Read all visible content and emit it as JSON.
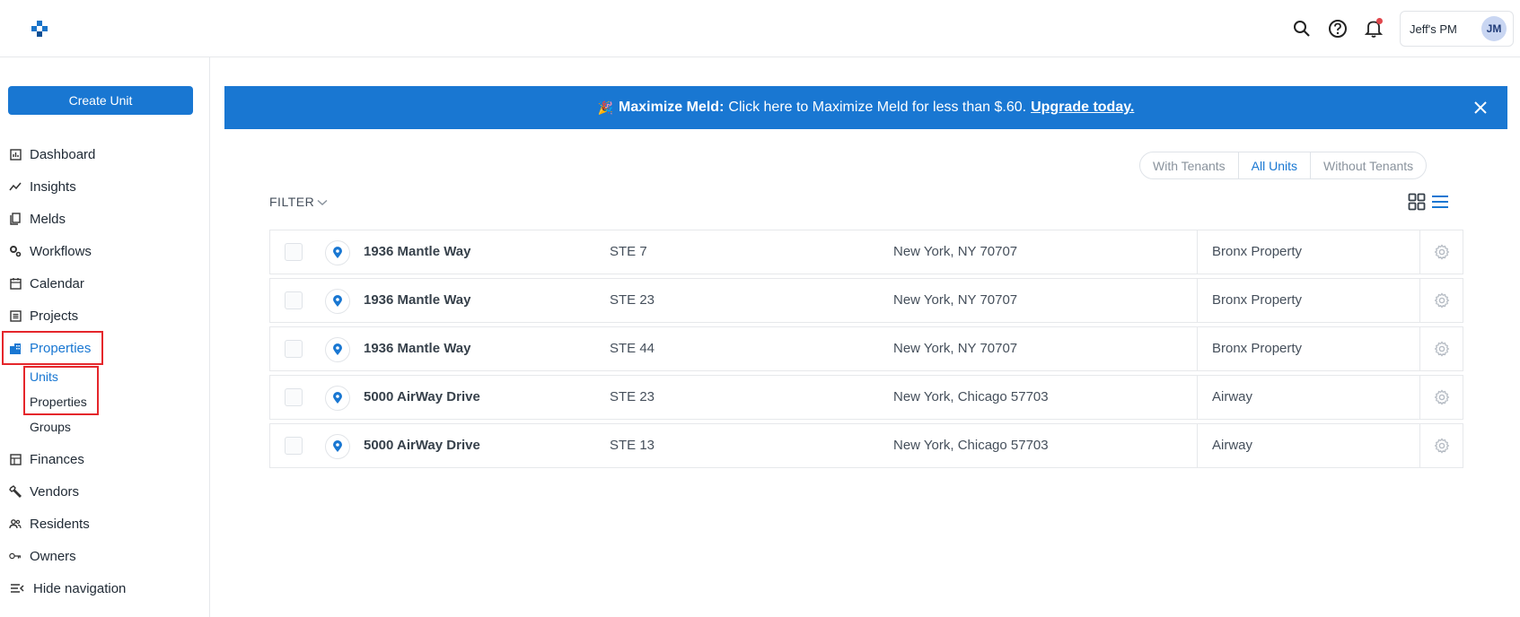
{
  "header": {
    "account_name": "Jeff's PM",
    "avatar_initials": "JM",
    "icons": [
      "logo-icon",
      "search-icon",
      "help-icon",
      "bell-icon"
    ]
  },
  "sidebar": {
    "create_button": "Create Unit",
    "items": [
      {
        "label": "Dashboard",
        "icon": "dashboard-icon"
      },
      {
        "label": "Insights",
        "icon": "insights-icon"
      },
      {
        "label": "Melds",
        "icon": "melds-icon"
      },
      {
        "label": "Workflows",
        "icon": "workflows-icon"
      },
      {
        "label": "Calendar",
        "icon": "calendar-icon"
      },
      {
        "label": "Projects",
        "icon": "projects-icon"
      },
      {
        "label": "Properties",
        "icon": "properties-icon",
        "active": true
      },
      {
        "label": "Finances",
        "icon": "finances-icon"
      },
      {
        "label": "Vendors",
        "icon": "vendors-icon"
      },
      {
        "label": "Residents",
        "icon": "residents-icon"
      },
      {
        "label": "Owners",
        "icon": "owners-icon"
      },
      {
        "label": "Hide navigation",
        "icon": "hide-nav-icon"
      }
    ],
    "sub_items": [
      {
        "label": "Units",
        "active": true
      },
      {
        "label": "Properties"
      },
      {
        "label": "Groups"
      }
    ]
  },
  "banner": {
    "emoji": "🎉",
    "strong": "Maximize Meld:",
    "text": "Click here to Maximize Meld for less than $.60.",
    "link": "Upgrade today."
  },
  "segments": [
    {
      "label": "With Tenants"
    },
    {
      "label": "All Units",
      "active": true
    },
    {
      "label": "Without Tenants"
    }
  ],
  "filter_label": "FILTER",
  "units": [
    {
      "address": "1936 Mantle Way",
      "unit": "STE 7",
      "city": "New York, NY 70707",
      "property": "Bronx Property"
    },
    {
      "address": "1936 Mantle Way",
      "unit": "STE 23",
      "city": "New York, NY 70707",
      "property": "Bronx Property"
    },
    {
      "address": "1936 Mantle Way",
      "unit": "STE 44",
      "city": "New York, NY 70707",
      "property": "Bronx Property"
    },
    {
      "address": "5000 AirWay Drive",
      "unit": "STE 23",
      "city": "New York, Chicago 57703",
      "property": "Airway"
    },
    {
      "address": "5000 AirWay Drive",
      "unit": "STE 13",
      "city": "New York, Chicago 57703",
      "property": "Airway"
    }
  ],
  "colors": {
    "accent": "#1977d2",
    "highlight": "#e5262b",
    "text": "#212b36"
  }
}
